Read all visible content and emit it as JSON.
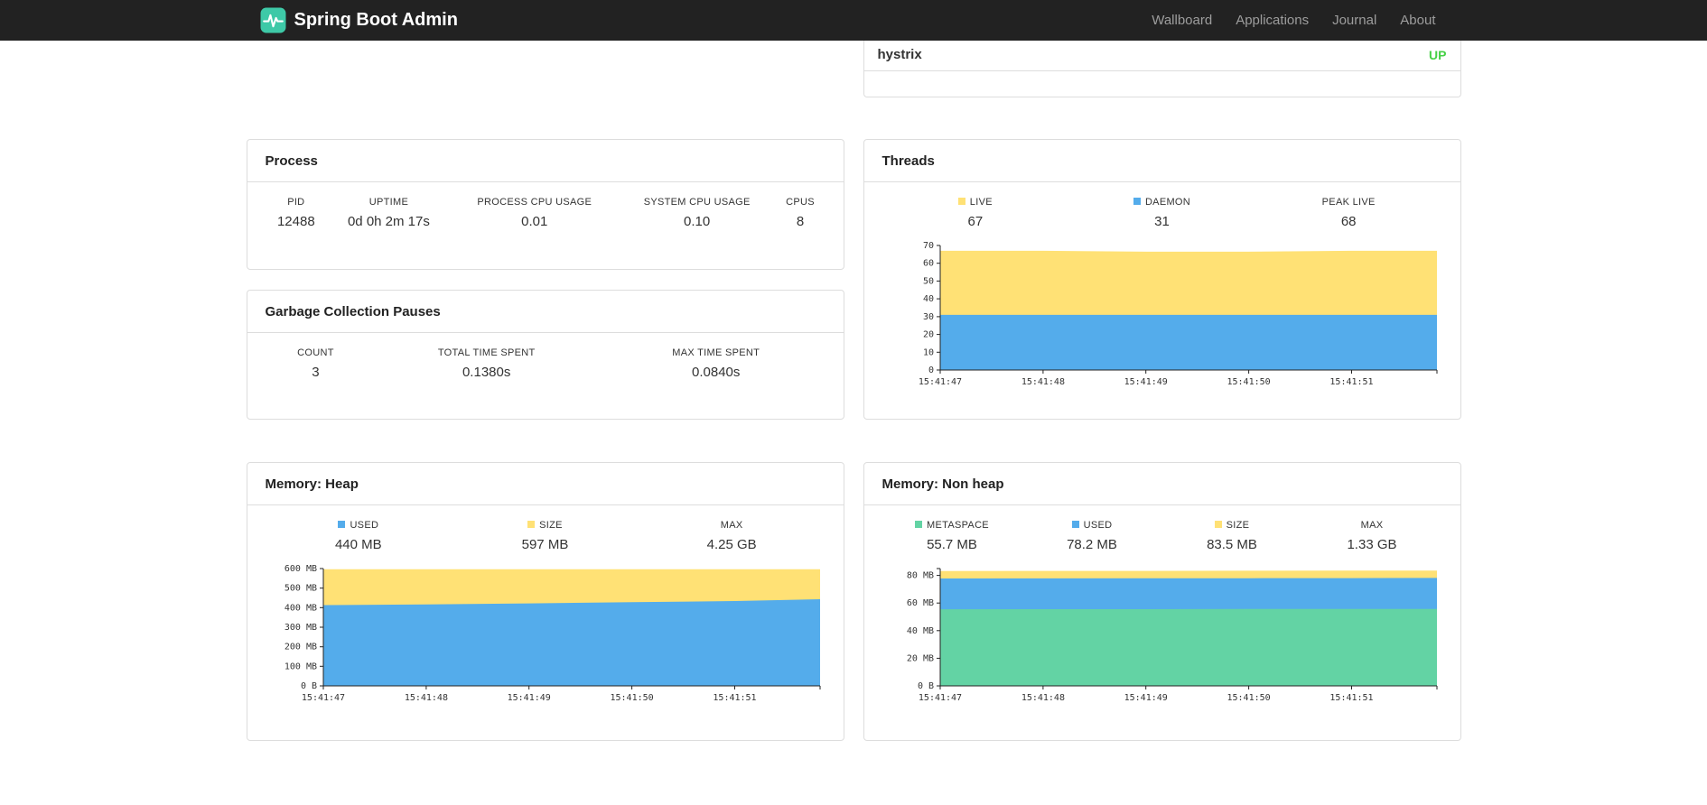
{
  "navbar": {
    "brand": "Spring Boot Admin",
    "links": [
      {
        "label": "Wallboard"
      },
      {
        "label": "Applications"
      },
      {
        "label": "Journal"
      },
      {
        "label": "About"
      }
    ]
  },
  "health_panel": {
    "row_label": "hystrix",
    "status": "UP",
    "status_color": "#47d147"
  },
  "panels": {
    "process": {
      "title": "Process",
      "columns": [
        "PID",
        "UPTIME",
        "PROCESS CPU USAGE",
        "SYSTEM CPU USAGE",
        "CPUS"
      ],
      "values": [
        "12488",
        "0d 0h 2m 17s",
        "0.01",
        "0.10",
        "8"
      ]
    },
    "gc": {
      "title": "Garbage Collection Pauses",
      "columns": [
        "COUNT",
        "TOTAL TIME SPENT",
        "MAX TIME SPENT"
      ],
      "values": [
        "3",
        "0.1380s",
        "0.0840s"
      ]
    },
    "threads": {
      "title": "Threads",
      "legend": [
        {
          "label": "LIVE",
          "value": "67",
          "color": "#ffe175"
        },
        {
          "label": "DAEMON",
          "value": "31",
          "color": "#54aceb"
        },
        {
          "label": "PEAK LIVE",
          "value": "68"
        }
      ]
    },
    "heap": {
      "title": "Memory: Heap",
      "legend": [
        {
          "label": "USED",
          "value": "440 MB",
          "color": "#54aceb"
        },
        {
          "label": "SIZE",
          "value": "597 MB",
          "color": "#ffe175"
        },
        {
          "label": "MAX",
          "value": "4.25 GB"
        }
      ]
    },
    "nonheap": {
      "title": "Memory: Non heap",
      "legend": [
        {
          "label": "METASPACE",
          "value": "55.7 MB",
          "color": "#63d3a4"
        },
        {
          "label": "USED",
          "value": "78.2 MB",
          "color": "#54aceb"
        },
        {
          "label": "SIZE",
          "value": "83.5 MB",
          "color": "#ffe175"
        },
        {
          "label": "MAX",
          "value": "1.33 GB"
        }
      ]
    }
  },
  "chart_data": [
    {
      "id": "threads",
      "title": "Threads",
      "type": "area",
      "stacked": true,
      "values_are": "stack_top",
      "x": [
        0,
        1,
        2,
        3,
        4,
        4.83
      ],
      "xlim": [
        0,
        4.83
      ],
      "x_tick_positions": [
        0,
        1,
        2,
        3,
        4
      ],
      "x_tick_labels": [
        "15:41:47",
        "15:41:48",
        "15:41:49",
        "15:41:50",
        "15:41:51"
      ],
      "ylim": [
        0,
        70
      ],
      "y_ticks": [
        0,
        10,
        20,
        30,
        40,
        50,
        60,
        70
      ],
      "y_tick_labels": [
        "0",
        "10",
        "20",
        "30",
        "40",
        "50",
        "60",
        "70"
      ],
      "series": [
        {
          "name": "LIVE",
          "color": "#ffe175",
          "values": [
            67,
            67,
            66.5,
            66.5,
            67,
            67
          ]
        },
        {
          "name": "DAEMON",
          "color": "#54aceb",
          "values": [
            31,
            31,
            31,
            31,
            31,
            31
          ]
        }
      ]
    },
    {
      "id": "heap",
      "title": "Memory: Heap",
      "type": "area",
      "stacked": true,
      "values_are": "stack_top",
      "x": [
        0,
        1,
        2,
        3,
        4,
        4.83
      ],
      "xlim": [
        0,
        4.83
      ],
      "x_tick_positions": [
        0,
        1,
        2,
        3,
        4
      ],
      "x_tick_labels": [
        "15:41:47",
        "15:41:48",
        "15:41:49",
        "15:41:50",
        "15:41:51"
      ],
      "ylim": [
        0,
        600
      ],
      "y_ticks": [
        0,
        100,
        200,
        300,
        400,
        500,
        600
      ],
      "y_tick_labels": [
        "0 B",
        "100 MB",
        "200 MB",
        "300 MB",
        "400 MB",
        "500 MB",
        "600 MB"
      ],
      "series": [
        {
          "name": "SIZE",
          "color": "#ffe175",
          "values": [
            597,
            597,
            597,
            597,
            597,
            597
          ]
        },
        {
          "name": "USED",
          "color": "#54aceb",
          "values": [
            413,
            417,
            422,
            428,
            434,
            443
          ]
        }
      ]
    },
    {
      "id": "nonheap",
      "title": "Memory: Non heap",
      "type": "area",
      "stacked": true,
      "values_are": "stack_top",
      "x": [
        0,
        1,
        2,
        3,
        4,
        4.83
      ],
      "xlim": [
        0,
        4.83
      ],
      "x_tick_positions": [
        0,
        1,
        2,
        3,
        4
      ],
      "x_tick_labels": [
        "15:41:47",
        "15:41:48",
        "15:41:49",
        "15:41:50",
        "15:41:51"
      ],
      "ylim": [
        0,
        85
      ],
      "y_ticks": [
        0,
        20,
        40,
        60,
        80
      ],
      "y_tick_labels": [
        "0 B",
        "20 MB",
        "40 MB",
        "60 MB",
        "80 MB"
      ],
      "series": [
        {
          "name": "SIZE",
          "color": "#ffe175",
          "values": [
            83.2,
            83.3,
            83.3,
            83.4,
            83.5,
            83.5
          ]
        },
        {
          "name": "USED",
          "color": "#54aceb",
          "values": [
            77.8,
            77.9,
            78.0,
            78.0,
            78.1,
            78.2
          ]
        },
        {
          "name": "METASPACE",
          "color": "#63d3a4",
          "values": [
            55.5,
            55.6,
            55.6,
            55.7,
            55.7,
            55.7
          ]
        }
      ]
    }
  ]
}
